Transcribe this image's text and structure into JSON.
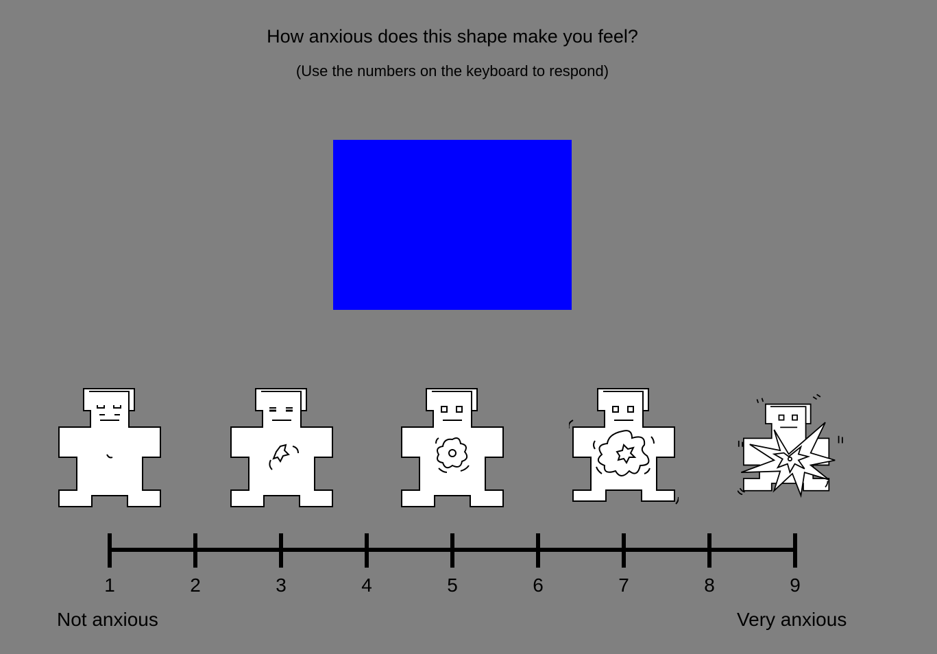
{
  "prompt": {
    "question": "How anxious does this shape make you feel?",
    "instruction": "(Use the numbers on the keyboard to respond)"
  },
  "stimulus": {
    "shape": "rectangle",
    "color": "#0000ff"
  },
  "manikins": [
    {
      "level": 1,
      "icon": "calm-manikin-icon"
    },
    {
      "level": 3,
      "icon": "slightly-anxious-manikin-icon"
    },
    {
      "level": 5,
      "icon": "moderately-anxious-manikin-icon"
    },
    {
      "level": 7,
      "icon": "anxious-manikin-icon"
    },
    {
      "level": 9,
      "icon": "exploding-manikin-icon"
    }
  ],
  "scale": {
    "ticks": [
      "1",
      "2",
      "3",
      "4",
      "5",
      "6",
      "7",
      "8",
      "9"
    ],
    "low_anchor": "Not anxious",
    "high_anchor": "Very anxious"
  },
  "colors": {
    "background": "#808080",
    "figure_fill": "#ffffff",
    "line": "#000000"
  }
}
